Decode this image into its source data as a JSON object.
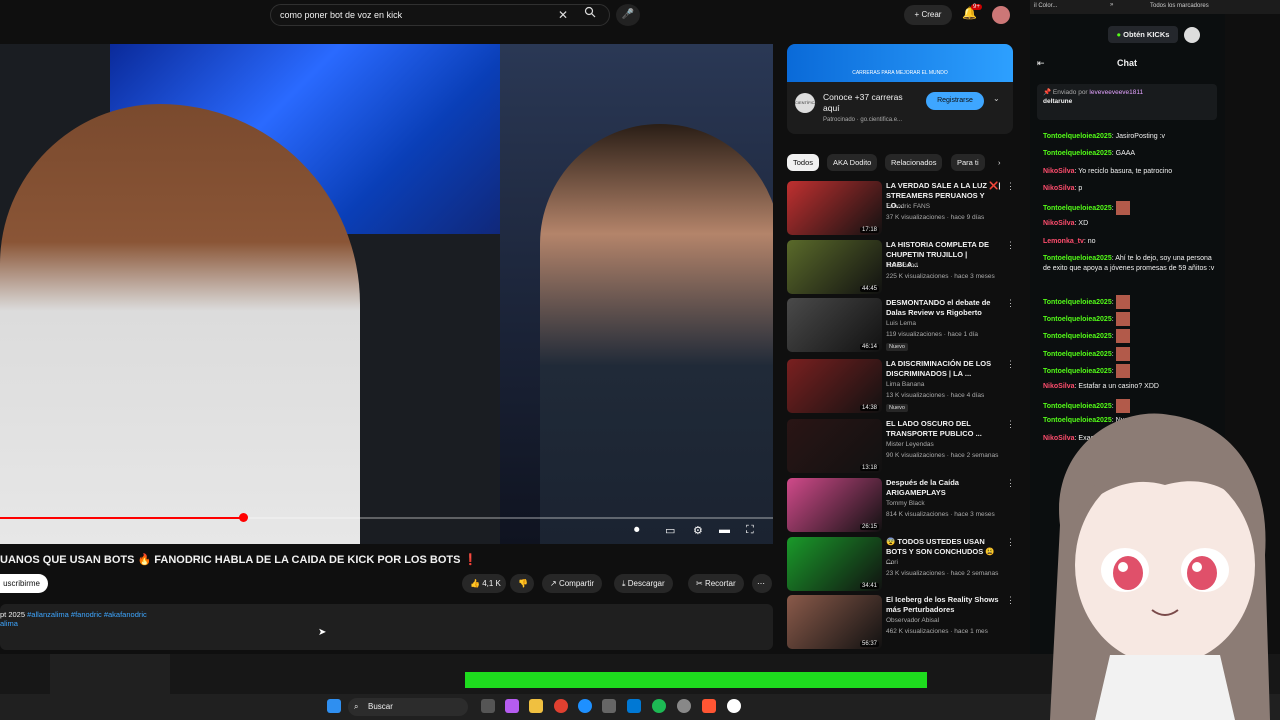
{
  "header": {
    "search_value": "como poner bot de voz en kick",
    "create_label": "Crear",
    "notif_count": "9+"
  },
  "player": {
    "progress": 0.315
  },
  "video": {
    "title": "UANOS QUE USAN BOTS 🔥 FANODRIC HABLA DE LA CAIDA DE KICK POR LOS BOTS ❗",
    "subscribe_label": "uscribirme",
    "likes": "4,1 K",
    "share_label": "Compartir",
    "download_label": "Descargar",
    "clip_label": "Recortar",
    "description_date": "pt 2025",
    "description_tags": "#allanzalima #fanodric #akafanodric",
    "description_tag2": "alima"
  },
  "ad": {
    "banner_text": "CARRERAS PARA MEJORAR EL MUNDO",
    "logo": "CIENTÍFICA",
    "title": "Conoce +37 carreras aquí",
    "sponsor": "Patrocinado · go.cientifica.e...",
    "cta": "Registrarse"
  },
  "chips": [
    "Todos",
    "AKA Dodito",
    "Relacionados",
    "Para ti"
  ],
  "recommendations": [
    {
      "title": "LA VERDAD SALE A LA LUZ ❌| STREAMERS PERUANOS Y LO...",
      "channel": "Fanodric FANS",
      "meta": "37 K visualizaciones · hace 9 días",
      "duration": "17:18",
      "thumb_color": "#c03030",
      "badge": ""
    },
    {
      "title": "LA HISTORIA COMPLETA DE CHUPETIN TRUJILLO | HABLA...",
      "channel": "Todo Good",
      "meta": "225 K visualizaciones · hace 3 meses",
      "duration": "44:45",
      "thumb_color": "#5a6a2a",
      "badge": ""
    },
    {
      "title": "DESMONTANDO el debate de Dalas Review vs Rigoberto",
      "channel": "Luis Lema",
      "meta": "119 visualizaciones · hace 1 día",
      "duration": "46:14",
      "thumb_color": "#4a4a4a",
      "badge": "Nuevo"
    },
    {
      "title": "LA DISCRIMINACIÓN DE LOS DISCRIMINADOS | LA ...",
      "channel": "Lima Banana",
      "meta": "13 K visualizaciones · hace 4 días",
      "duration": "14:38",
      "thumb_color": "#7a2020",
      "badge": "Nuevo"
    },
    {
      "title": "EL LADO OSCURO DEL TRANSPORTE PUBLICO ...",
      "channel": "Mister Leyendas",
      "meta": "90 K visualizaciones · hace 2 semanas",
      "duration": "13:18",
      "thumb_color": "#2a1515",
      "badge": ""
    },
    {
      "title": "Después de la Caída ARIGAMEPLAYS",
      "channel": "Tommy Black",
      "meta": "814 K visualizaciones · hace 3 meses",
      "duration": "26:15",
      "thumb_color": "#d04a8a",
      "badge": ""
    },
    {
      "title": "😨 TODOS USTEDES USAN BOTS Y SON CONCHUDOS 😩 ...",
      "channel": "Cori",
      "meta": "23 K visualizaciones · hace 2 semanas",
      "duration": "34:41",
      "thumb_color": "#1a9a2a",
      "badge": ""
    },
    {
      "title": "El Iceberg de los Reality Shows más Perturbadores",
      "channel": "Observador Abisal",
      "meta": "462 K visualizaciones · hace 1 mes",
      "duration": "56:37",
      "thumb_color": "#8a5a4a",
      "badge": ""
    }
  ],
  "browser": {
    "tab_text": "il Color...",
    "bookmarks": "Todos los marcadores"
  },
  "chat": {
    "kick_label": "Obtén KICKs",
    "title": "Chat",
    "pinned_by": "Enviado por",
    "pinned_user": "leveveeveeve1811",
    "pinned_text": "deltarune",
    "messages": [
      {
        "user": "Tontoelqueloiea2025",
        "text": ": JasiroPosting :v",
        "color": "#53fc18",
        "emote": false
      },
      {
        "user": "Tontoelqueloiea2025",
        "text": ": GAAA",
        "color": "#53fc18",
        "emote": false
      },
      {
        "user": "NikoSilva",
        "text": ": Yo reciclo basura, te patrocino",
        "color": "#ff4d6d",
        "emote": false
      },
      {
        "user": "NikoSilva",
        "text": ": p",
        "color": "#ff4d6d",
        "emote": false
      },
      {
        "user": "Tontoelqueloiea2025",
        "text": ":",
        "color": "#53fc18",
        "emote": true
      },
      {
        "user": "NikoSilva",
        "text": ": XD",
        "color": "#ff4d6d",
        "emote": false
      },
      {
        "user": "Lemonka_tv",
        "text": ": no",
        "color": "#ff4d6d",
        "emote": false
      },
      {
        "user": "Tontoelqueloiea2025",
        "text": ": Ahí te lo dejo, soy una persona de exito que apoya a jóvenes promesas de 59 añitos :v",
        "color": "#53fc18",
        "emote": false
      },
      {
        "user": "Tontoelqueloiea2025",
        "text": ":",
        "color": "#53fc18",
        "emote": true
      },
      {
        "user": "Tontoelqueloiea2025",
        "text": ":",
        "color": "#53fc18",
        "emote": true
      },
      {
        "user": "Tontoelqueloiea2025",
        "text": ":",
        "color": "#53fc18",
        "emote": true
      },
      {
        "user": "Tontoelqueloiea2025",
        "text": ":",
        "color": "#53fc18",
        "emote": true
      },
      {
        "user": "Tontoelqueloiea2025",
        "text": ":",
        "color": "#53fc18",
        "emote": true
      },
      {
        "user": "NikoSilva",
        "text": ": Estafar a un casino? XDD",
        "color": "#ff4d6d",
        "emote": false
      },
      {
        "user": "Tontoelqueloiea2025",
        "text": ":",
        "color": "#53fc18",
        "emote": true
      },
      {
        "user": "Tontoelqueloiea2025",
        "text": ": Nunca",
        "color": "#53fc18",
        "emote": false
      },
      {
        "user": "NikoSilva",
        "text": ": Exactame",
        "color": "#ff4d6d",
        "emote": false
      }
    ]
  },
  "taskbar": {
    "search_label": "Buscar"
  }
}
